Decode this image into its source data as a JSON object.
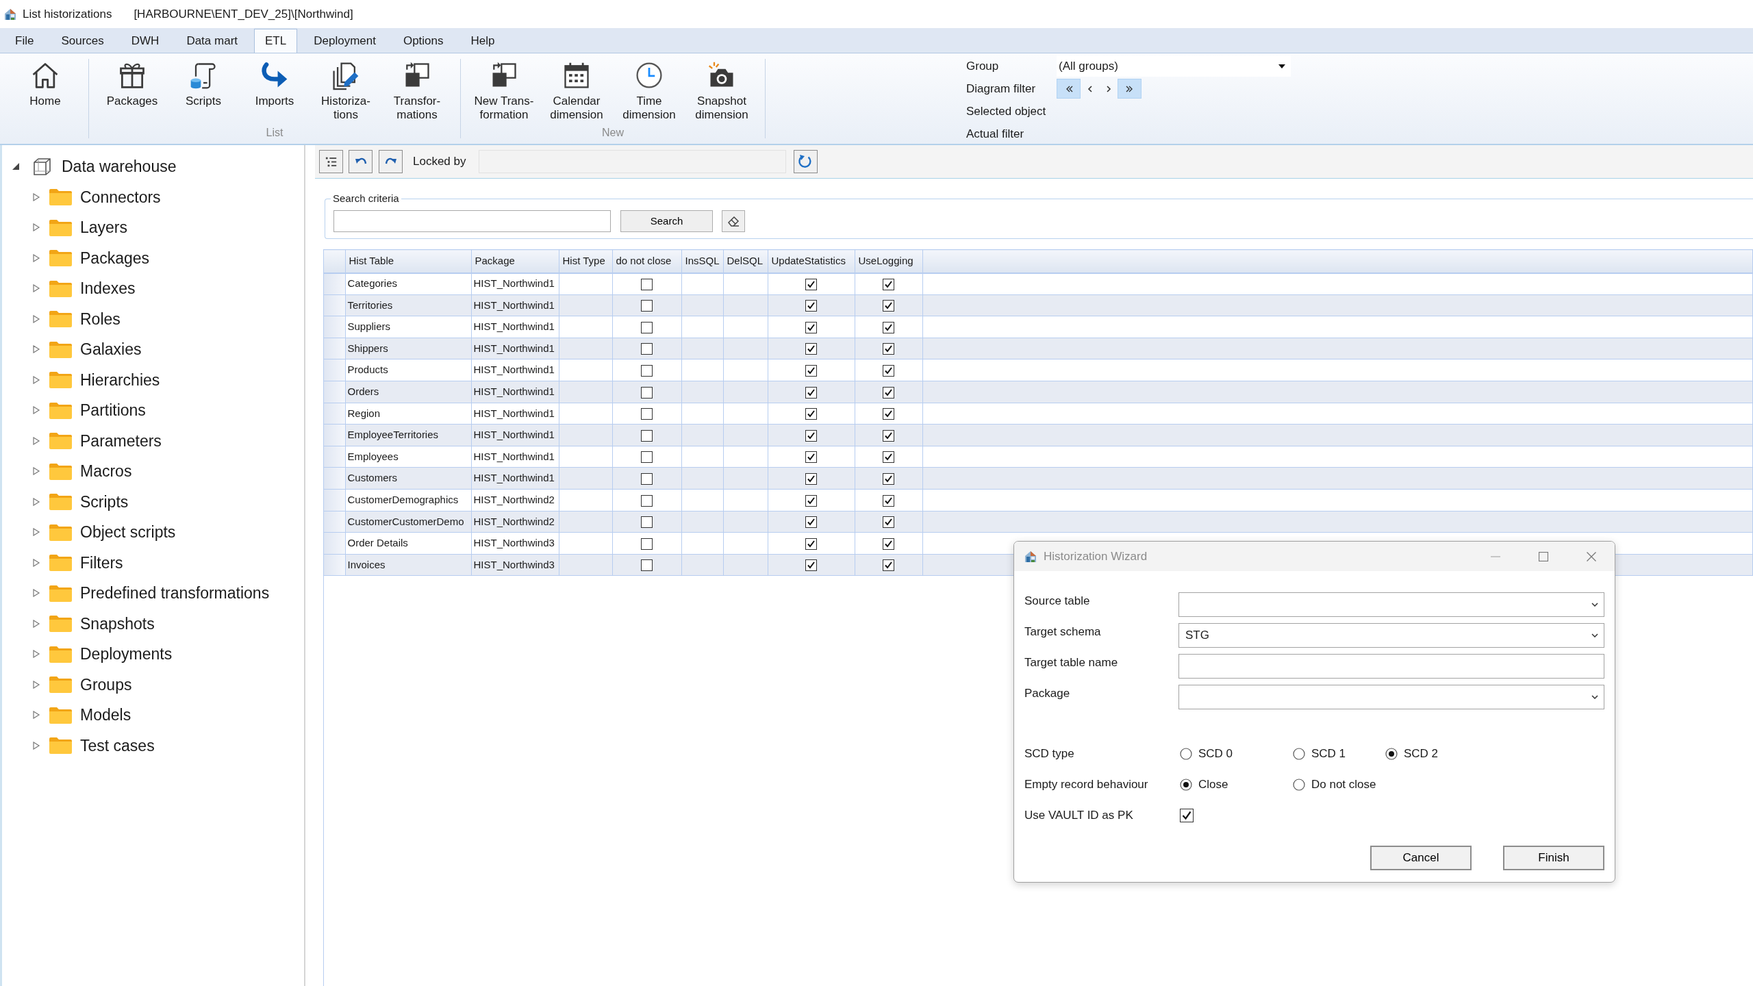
{
  "window": {
    "title": "List historizations",
    "context": "[HARBOURNE\\ENT_DEV_25]\\[Northwind]"
  },
  "menu_tabs": [
    {
      "label": "File",
      "selected": false
    },
    {
      "label": "Sources",
      "selected": false
    },
    {
      "label": "DWH",
      "selected": false
    },
    {
      "label": "Data mart",
      "selected": false
    },
    {
      "label": "ETL",
      "selected": true
    },
    {
      "label": "Deployment",
      "selected": false
    },
    {
      "label": "Options",
      "selected": false
    },
    {
      "label": "Help",
      "selected": false
    }
  ],
  "ribbon": {
    "groups": [
      {
        "buttons": [
          "Home"
        ]
      },
      {
        "label": "List",
        "buttons": [
          "Packages",
          "Scripts",
          "Imports",
          "Historiza-\ntions",
          "Transfor-\nmations"
        ]
      },
      {
        "label": "New",
        "buttons": [
          "New Trans-\nformation",
          "Calendar\ndimension",
          "Time\ndimension",
          "Snapshot\ndimension"
        ]
      }
    ],
    "filters": {
      "group": {
        "label": "Group",
        "value": "(All groups)"
      },
      "diagram_filter": {
        "label": "Diagram filter",
        "nav_buttons": [
          {
            "highlighted": true
          },
          {
            "highlighted": false
          },
          {
            "highlighted": false
          },
          {
            "highlighted": true
          }
        ]
      },
      "selected_object": {
        "label": "Selected object"
      },
      "actual_filter": {
        "label": "Actual filter"
      }
    }
  },
  "tree": {
    "label": "Data warehouse",
    "expanded": true,
    "children": [
      {
        "label": "Connectors",
        "expanded": false
      },
      {
        "label": "Layers",
        "expanded": false
      },
      {
        "label": "Packages",
        "expanded": false
      },
      {
        "label": "Indexes",
        "expanded": false
      },
      {
        "label": "Roles",
        "expanded": false
      },
      {
        "label": "Galaxies",
        "expanded": false
      },
      {
        "label": "Hierarchies",
        "expanded": false
      },
      {
        "label": "Partitions",
        "expanded": false
      },
      {
        "label": "Parameters",
        "expanded": false
      },
      {
        "label": "Macros",
        "expanded": false
      },
      {
        "label": "Scripts",
        "expanded": false
      },
      {
        "label": "Object scripts",
        "expanded": false
      },
      {
        "label": "Filters",
        "expanded": false
      },
      {
        "label": "Predefined transformations",
        "expanded": false
      },
      {
        "label": "Snapshots",
        "expanded": false
      },
      {
        "label": "Deployments",
        "expanded": false
      },
      {
        "label": "Groups",
        "expanded": false
      },
      {
        "label": "Models",
        "expanded": false
      },
      {
        "label": "Test cases",
        "expanded": false
      }
    ]
  },
  "toolbar": {
    "locked_by": {
      "label": "Locked by"
    }
  },
  "search": {
    "legend": "Search criteria",
    "button": "Search"
  },
  "table": {
    "columns": [
      "Hist Table",
      "Package",
      "Hist Type",
      "do not close",
      "InsSQL",
      "DelSQL",
      "UpdateStatistics",
      "UseLogging"
    ],
    "rows": [
      {
        "hist_table": "Categories",
        "package": "HIST_Northwind1",
        "do_not_close": false,
        "update_statistics": true,
        "use_logging": true
      },
      {
        "hist_table": "Territories",
        "package": "HIST_Northwind1",
        "do_not_close": false,
        "update_statistics": true,
        "use_logging": true
      },
      {
        "hist_table": "Suppliers",
        "package": "HIST_Northwind1",
        "do_not_close": false,
        "update_statistics": true,
        "use_logging": true
      },
      {
        "hist_table": "Shippers",
        "package": "HIST_Northwind1",
        "do_not_close": false,
        "update_statistics": true,
        "use_logging": true
      },
      {
        "hist_table": "Products",
        "package": "HIST_Northwind1",
        "do_not_close": false,
        "update_statistics": true,
        "use_logging": true
      },
      {
        "hist_table": "Orders",
        "package": "HIST_Northwind1",
        "do_not_close": false,
        "update_statistics": true,
        "use_logging": true
      },
      {
        "hist_table": "Region",
        "package": "HIST_Northwind1",
        "do_not_close": false,
        "update_statistics": true,
        "use_logging": true
      },
      {
        "hist_table": "EmployeeTerritories",
        "package": "HIST_Northwind1",
        "do_not_close": false,
        "update_statistics": true,
        "use_logging": true
      },
      {
        "hist_table": "Employees",
        "package": "HIST_Northwind1",
        "do_not_close": false,
        "update_statistics": true,
        "use_logging": true
      },
      {
        "hist_table": "Customers",
        "package": "HIST_Northwind1",
        "do_not_close": false,
        "update_statistics": true,
        "use_logging": true
      },
      {
        "hist_table": "CustomerDemographics",
        "package": "HIST_Northwind2",
        "do_not_close": false,
        "update_statistics": true,
        "use_logging": true
      },
      {
        "hist_table": "CustomerCustomerDemo",
        "package": "HIST_Northwind2",
        "do_not_close": false,
        "update_statistics": true,
        "use_logging": true
      },
      {
        "hist_table": "Order Details",
        "package": "HIST_Northwind3",
        "do_not_close": false,
        "update_statistics": true,
        "use_logging": true
      },
      {
        "hist_table": "Invoices",
        "package": "HIST_Northwind3",
        "do_not_close": false,
        "update_statistics": true,
        "use_logging": true
      }
    ]
  },
  "dialog": {
    "title": "Historization Wizard",
    "fields": [
      {
        "label": "Source table",
        "kind": "dropdown"
      },
      {
        "label": "Target schema",
        "kind": "dropdown",
        "value": "STG"
      },
      {
        "label": "Target table name",
        "kind": "text"
      },
      {
        "label": "Package",
        "kind": "dropdown"
      }
    ],
    "scd_type": {
      "label": "SCD type",
      "options": [
        {
          "label": "SCD 0",
          "selected": false
        },
        {
          "label": "SCD 1",
          "selected": false
        },
        {
          "label": "SCD 2",
          "selected": true
        }
      ]
    },
    "empty_record_behaviour": {
      "label": "Empty record behaviour",
      "options": [
        {
          "label": "Close",
          "selected": true
        },
        {
          "label": "Do not close",
          "selected": false
        }
      ]
    },
    "use_vault_id_as_pk": {
      "label": "Use VAULT ID as PK",
      "checked": true
    },
    "buttons": [
      "Cancel",
      "Finish"
    ]
  }
}
